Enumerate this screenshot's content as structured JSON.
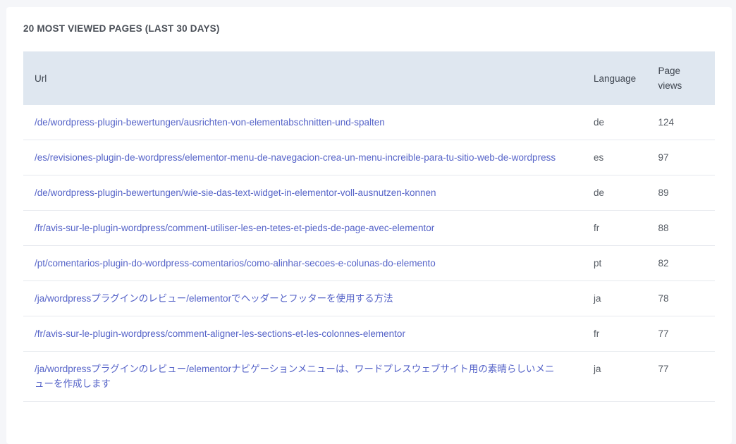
{
  "panel": {
    "title": "20 MOST VIEWED PAGES (LAST 30 DAYS)"
  },
  "table": {
    "columns": {
      "url": "Url",
      "language": "Language",
      "views": "Page views"
    },
    "rows": [
      {
        "url": "/de/wordpress-plugin-bewertungen/ausrichten-von-elementabschnitten-und-spalten",
        "language": "de",
        "views": "124"
      },
      {
        "url": "/es/revisiones-plugin-de-wordpress/elementor-menu-de-navegacion-crea-un-menu-increible-para-tu-sitio-web-de-wordpress",
        "language": "es",
        "views": "97"
      },
      {
        "url": "/de/wordpress-plugin-bewertungen/wie-sie-das-text-widget-in-elementor-voll-ausnutzen-konnen",
        "language": "de",
        "views": "89"
      },
      {
        "url": "/fr/avis-sur-le-plugin-wordpress/comment-utiliser-les-en-tetes-et-pieds-de-page-avec-elementor",
        "language": "fr",
        "views": "88"
      },
      {
        "url": "/pt/comentarios-plugin-do-wordpress-comentarios/como-alinhar-secoes-e-colunas-do-elemento",
        "language": "pt",
        "views": "82"
      },
      {
        "url": "/ja/wordpressプラグインのレビュー/elementorでヘッダーとフッターを使用する方法",
        "language": "ja",
        "views": "78"
      },
      {
        "url": "/fr/avis-sur-le-plugin-wordpress/comment-aligner-les-sections-et-les-colonnes-elementor",
        "language": "fr",
        "views": "77"
      },
      {
        "url": "/ja/wordpressプラグインのレビュー/elementorナビゲーションメニューは、ワードプレスウェブサイト用の素晴らしいメニューを作成します",
        "language": "ja",
        "views": "77"
      }
    ]
  }
}
